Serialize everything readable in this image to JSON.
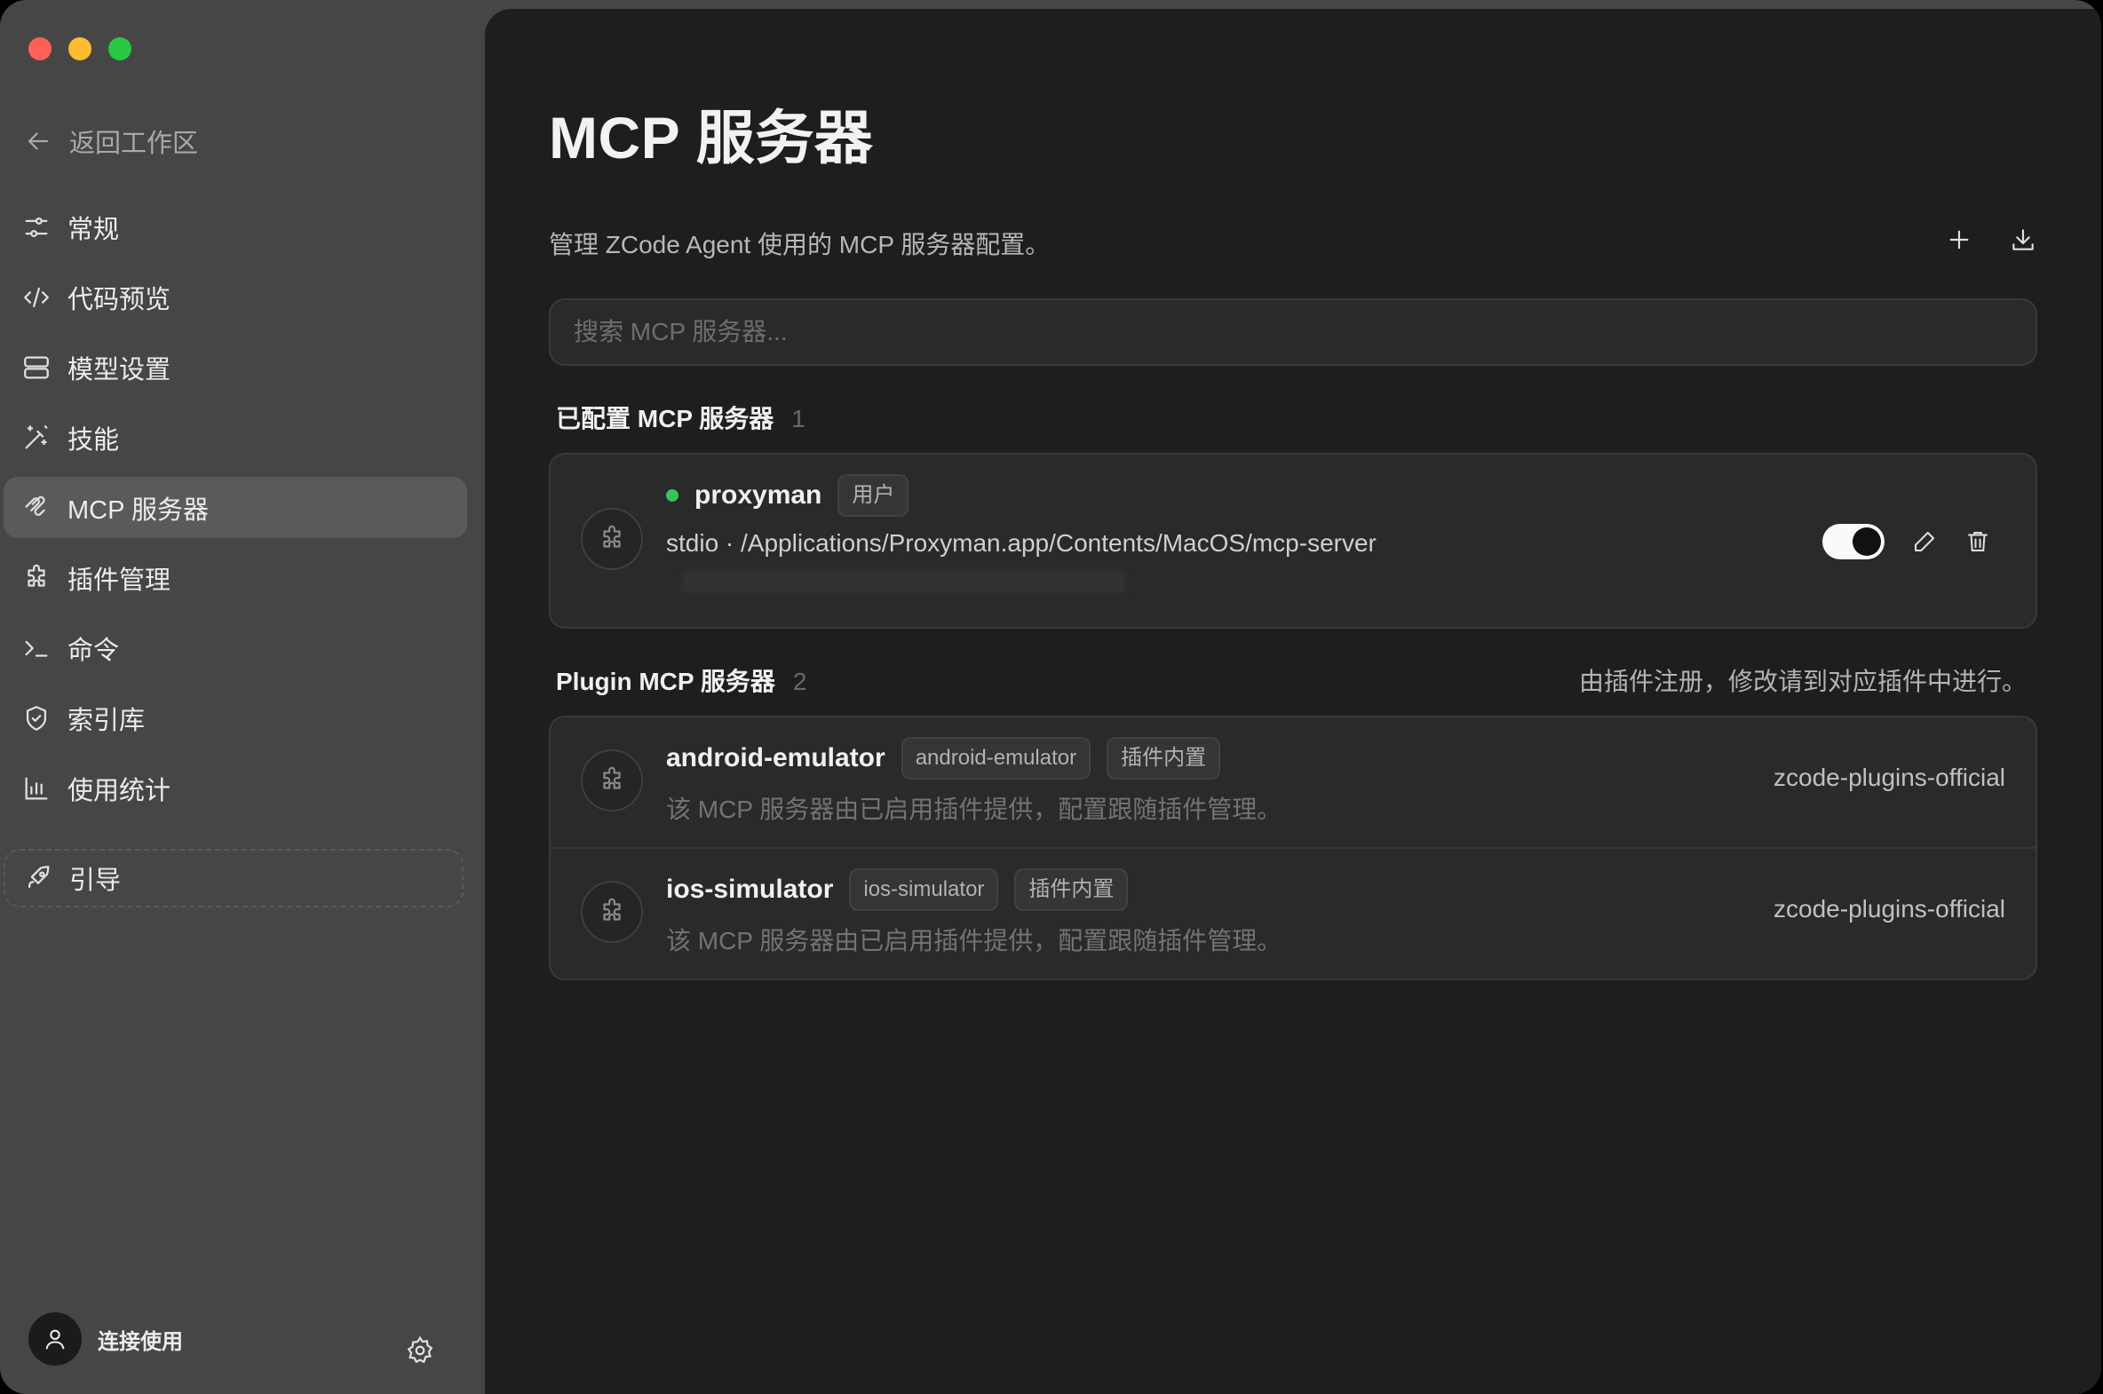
{
  "window": {
    "traffic_lights": [
      "close",
      "minimize",
      "zoom"
    ]
  },
  "sidebar": {
    "back_label": "返回工作区",
    "items": [
      {
        "label": "常规",
        "icon": "sliders-icon"
      },
      {
        "label": "代码预览",
        "icon": "code-icon"
      },
      {
        "label": "模型设置",
        "icon": "server-icon"
      },
      {
        "label": "技能",
        "icon": "magic-wand-icon"
      },
      {
        "label": "MCP 服务器",
        "icon": "mcp-icon",
        "active": true
      },
      {
        "label": "插件管理",
        "icon": "puzzle-icon"
      },
      {
        "label": "命令",
        "icon": "terminal-icon"
      },
      {
        "label": "索引库",
        "icon": "shield-icon"
      },
      {
        "label": "使用统计",
        "icon": "bar-chart-icon"
      }
    ],
    "guide_label": "引导",
    "account_label": "连接使用"
  },
  "main": {
    "title": "MCP 服务器",
    "subtitle": "管理 ZCode Agent 使用的 MCP 服务器配置。",
    "search_placeholder": "搜索 MCP 服务器...",
    "configured": {
      "heading": "已配置 MCP 服务器",
      "count": "1",
      "servers": [
        {
          "name": "proxyman",
          "tag": "用户",
          "status": "running",
          "detail": "stdio · /Applications/Proxyman.app/Contents/MacOS/mcp-server",
          "enabled": true
        }
      ]
    },
    "plugin": {
      "heading": "Plugin MCP 服务器",
      "count": "2",
      "note": "由插件注册，修改请到对应插件中进行。",
      "servers": [
        {
          "name": "android-emulator",
          "tag": "android-emulator",
          "tag2": "插件内置",
          "desc": "该 MCP 服务器由已启用插件提供，配置跟随插件管理。",
          "source": "zcode-plugins-official"
        },
        {
          "name": "ios-simulator",
          "tag": "ios-simulator",
          "tag2": "插件内置",
          "desc": "该 MCP 服务器由已启用插件提供，配置跟随插件管理。",
          "source": "zcode-plugins-official"
        }
      ]
    }
  },
  "colors": {
    "status_running": "#2fc65a",
    "sidebar_bg": "#464646",
    "main_bg": "#1e1e1e"
  }
}
